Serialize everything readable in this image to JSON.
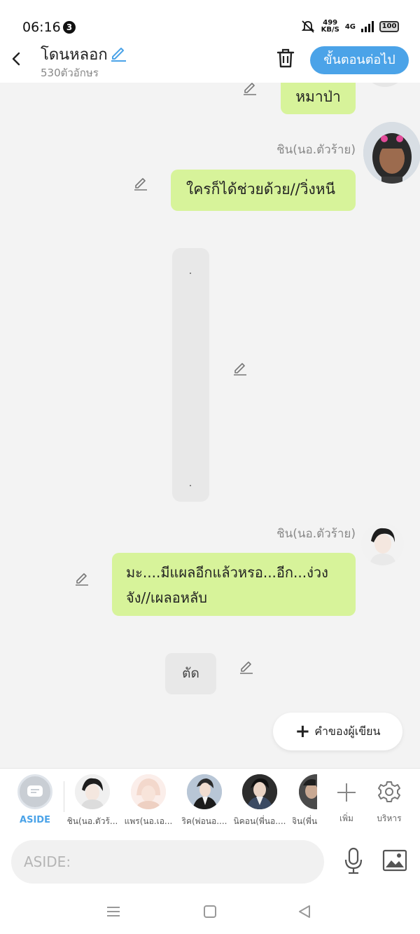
{
  "status_bar": {
    "time": "06:16",
    "notification_count": "3",
    "net_speed_value": "499",
    "net_speed_unit": "KB/S",
    "network": "4G",
    "battery": "100"
  },
  "header": {
    "title": "โดนหลอก",
    "char_count": "530ตัวอักษร",
    "next_label": "ขั้นตอนต่อไป"
  },
  "chat": {
    "messages": [
      {
        "speaker": "",
        "text": "หมาป่า"
      },
      {
        "speaker": "ชิน(นอ.ตัวร้าย)",
        "text": "ใครก็ได้ช่วยด้วย//วิ่งหนี"
      },
      {
        "speaker": "ชิน(นอ.ตัวร้าย)",
        "text_line1": "มะ....มีแผลอีกแล้วหรอ...อีก...ง่วง",
        "text_line2": "จัง//เผลอหลับ"
      }
    ],
    "cut_label": "ตัด",
    "author_note_label": "คำของผู้เขียน"
  },
  "character_bar": {
    "aside_label": "ASIDE",
    "characters": [
      {
        "name": "ชิน(นอ.ตัวร้..."
      },
      {
        "name": "แพร(นอ.เอ..."
      },
      {
        "name": "ริค(พ่อนอ...."
      },
      {
        "name": "นิคอน(พี่นอ...."
      },
      {
        "name": "จิน(พี่น"
      }
    ],
    "add_label": "เพิ่ม",
    "manage_label": "บริหาร"
  },
  "input": {
    "placeholder": "ASIDE:"
  },
  "colors": {
    "accent": "#4ba3e8",
    "bubble": "#d7f39a",
    "background": "#f3f3f3"
  },
  "icons": {
    "back": "chevron-left-icon",
    "edit": "pencil-icon",
    "delete": "trash-icon",
    "mic": "microphone-icon",
    "image": "image-icon",
    "add": "plus-icon",
    "settings": "gear-icon"
  }
}
